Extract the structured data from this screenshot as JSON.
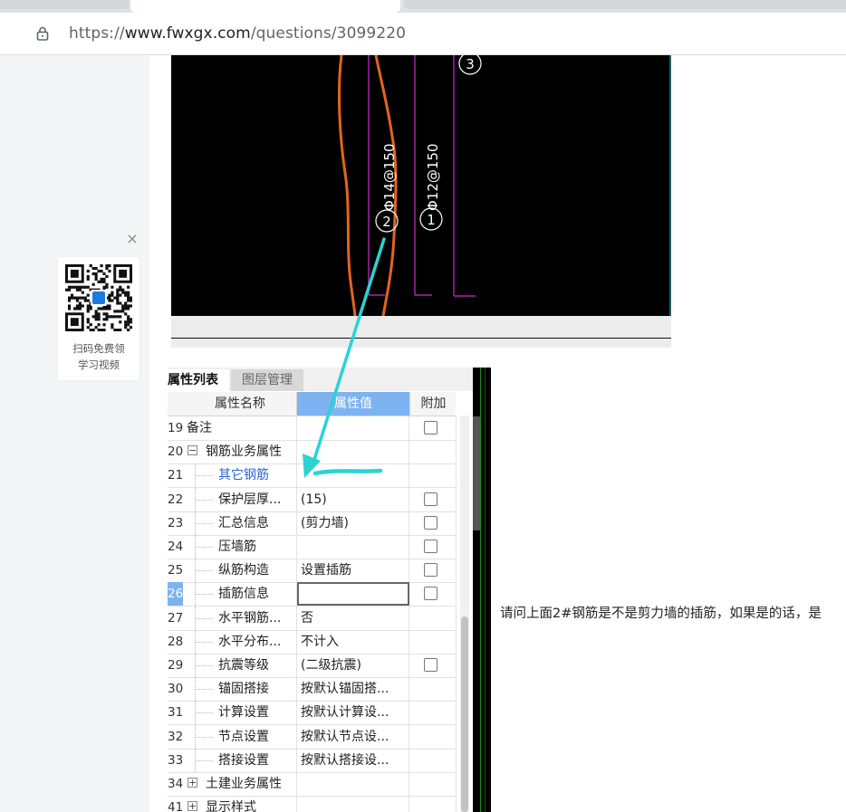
{
  "browser": {
    "url_prefix": "https://",
    "url_host": "www.fwxgx.com",
    "url_path": "/questions/3099220"
  },
  "qr_promo": {
    "close_glyph": "×",
    "line1": "扫码免费领",
    "line2": "学习视频"
  },
  "cad_drawing": {
    "labels": {
      "rebar_2": "Φ14@150",
      "rebar_1": "Φ12@150",
      "marker_1": "1",
      "marker_2": "2",
      "marker_3": "3"
    }
  },
  "property_panel": {
    "tabs": [
      "属性列表",
      "图层管理"
    ],
    "headers": {
      "name": "属性名称",
      "value": "属性值",
      "add": "附加"
    },
    "rows": [
      {
        "num": "19",
        "name": "备注",
        "value": "",
        "check": true,
        "indent": 0,
        "expander": ""
      },
      {
        "num": "20",
        "name": "钢筋业务属性",
        "value": "",
        "check": false,
        "indent": 1,
        "expander": "−"
      },
      {
        "num": "21",
        "name": "其它钢筋",
        "value": "",
        "check": false,
        "indent": 2,
        "expander": "",
        "highlight": true
      },
      {
        "num": "22",
        "name": "保护层厚...",
        "value": "(15)",
        "check": true,
        "indent": 2,
        "expander": ""
      },
      {
        "num": "23",
        "name": "汇总信息",
        "value": "(剪力墙)",
        "check": true,
        "indent": 2,
        "expander": ""
      },
      {
        "num": "24",
        "name": "压墙筋",
        "value": "",
        "check": true,
        "indent": 2,
        "expander": ""
      },
      {
        "num": "25",
        "name": "纵筋构造",
        "value": "设置插筋",
        "check": true,
        "indent": 2,
        "expander": ""
      },
      {
        "num": "26",
        "name": "插筋信息",
        "value": "",
        "check": true,
        "indent": 2,
        "expander": "",
        "selected": true
      },
      {
        "num": "27",
        "name": "水平钢筋...",
        "value": "否",
        "check": false,
        "indent": 2,
        "expander": ""
      },
      {
        "num": "28",
        "name": "水平分布...",
        "value": "不计入",
        "check": false,
        "indent": 2,
        "expander": ""
      },
      {
        "num": "29",
        "name": "抗震等级",
        "value": "(二级抗震)",
        "check": true,
        "indent": 2,
        "expander": ""
      },
      {
        "num": "30",
        "name": "锚固搭接",
        "value": "按默认锚固搭...",
        "check": false,
        "indent": 2,
        "expander": ""
      },
      {
        "num": "31",
        "name": "计算设置",
        "value": "按默认计算设...",
        "check": false,
        "indent": 2,
        "expander": ""
      },
      {
        "num": "32",
        "name": "节点设置",
        "value": "按默认节点设...",
        "check": false,
        "indent": 2,
        "expander": ""
      },
      {
        "num": "33",
        "name": "搭接设置",
        "value": "按默认搭接设...",
        "check": false,
        "indent": 2,
        "expander": ""
      },
      {
        "num": "34",
        "name": "土建业务属性",
        "value": "",
        "check": false,
        "indent": 1,
        "expander": "+"
      },
      {
        "num": "41",
        "name": "显示样式",
        "value": "",
        "check": false,
        "indent": 1,
        "expander": "+"
      }
    ]
  },
  "question_text": "请问上面2#钢筋是不是剪力墙的插筋，如果是的话，是",
  "colors": {
    "arrow": "#2ad3d3",
    "magenta_line": "#d02bd0",
    "orange_line": "#e2651f",
    "header_value_bg": "#7db3f0",
    "link_blue": "#2a64d8"
  }
}
